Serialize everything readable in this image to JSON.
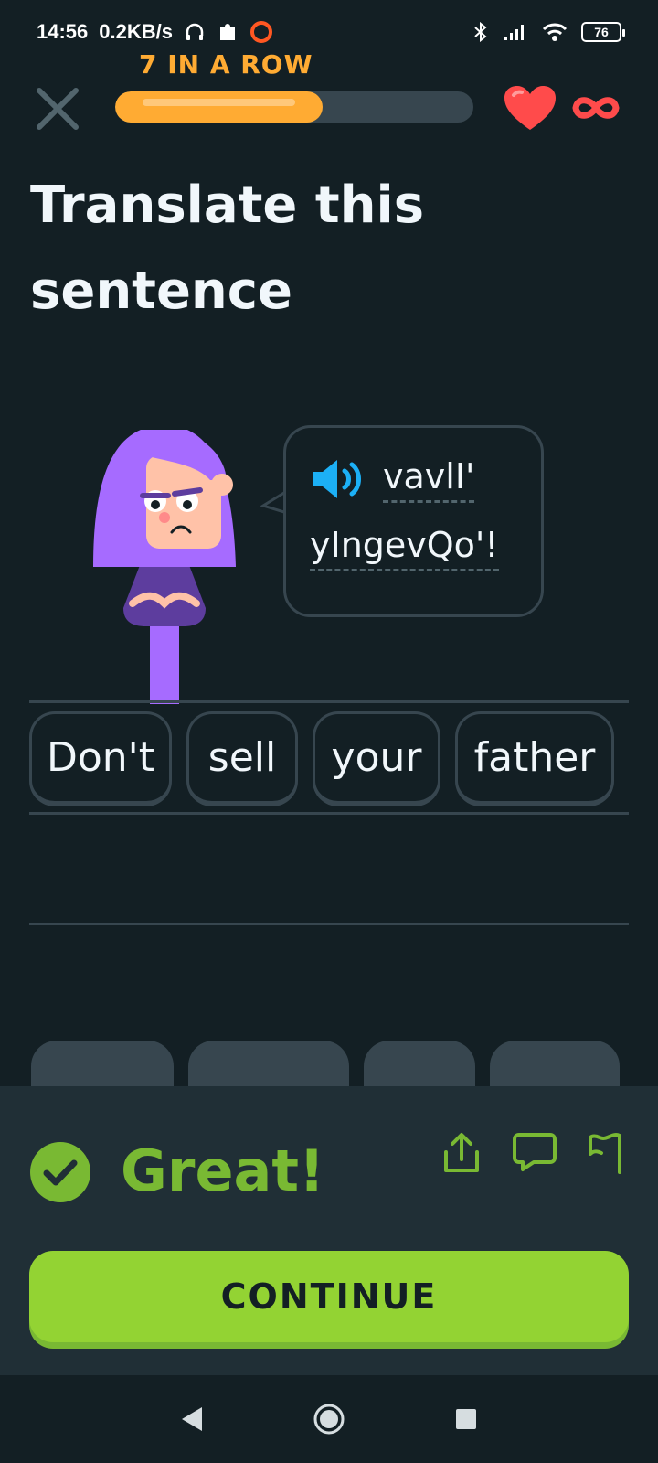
{
  "status_bar": {
    "time": "14:56",
    "speed": "0.2KB/s",
    "battery": "76"
  },
  "header": {
    "streak_label": "7 IN A ROW",
    "progress_fraction": 0.58,
    "hearts": "infinite"
  },
  "title": "Translate this sentence",
  "prompt": {
    "words": [
      "vavlI'",
      "yIngevQo'!"
    ]
  },
  "answer": {
    "chips": [
      "Don't",
      "sell",
      "your",
      "father"
    ]
  },
  "feedback": {
    "message": "Great!",
    "continue_label": "CONTINUE"
  },
  "colors": {
    "background": "#131f24",
    "accent_orange": "#ffab33",
    "success_green": "#93d333",
    "feedback_text": "#79b933",
    "heart_red": "#ff4b4b"
  },
  "icons": [
    "close-icon",
    "heart-icon",
    "infinity-icon",
    "speaker-icon",
    "check-icon",
    "share-icon",
    "comment-icon",
    "flag-icon",
    "back-icon",
    "home-icon",
    "recents-icon"
  ]
}
